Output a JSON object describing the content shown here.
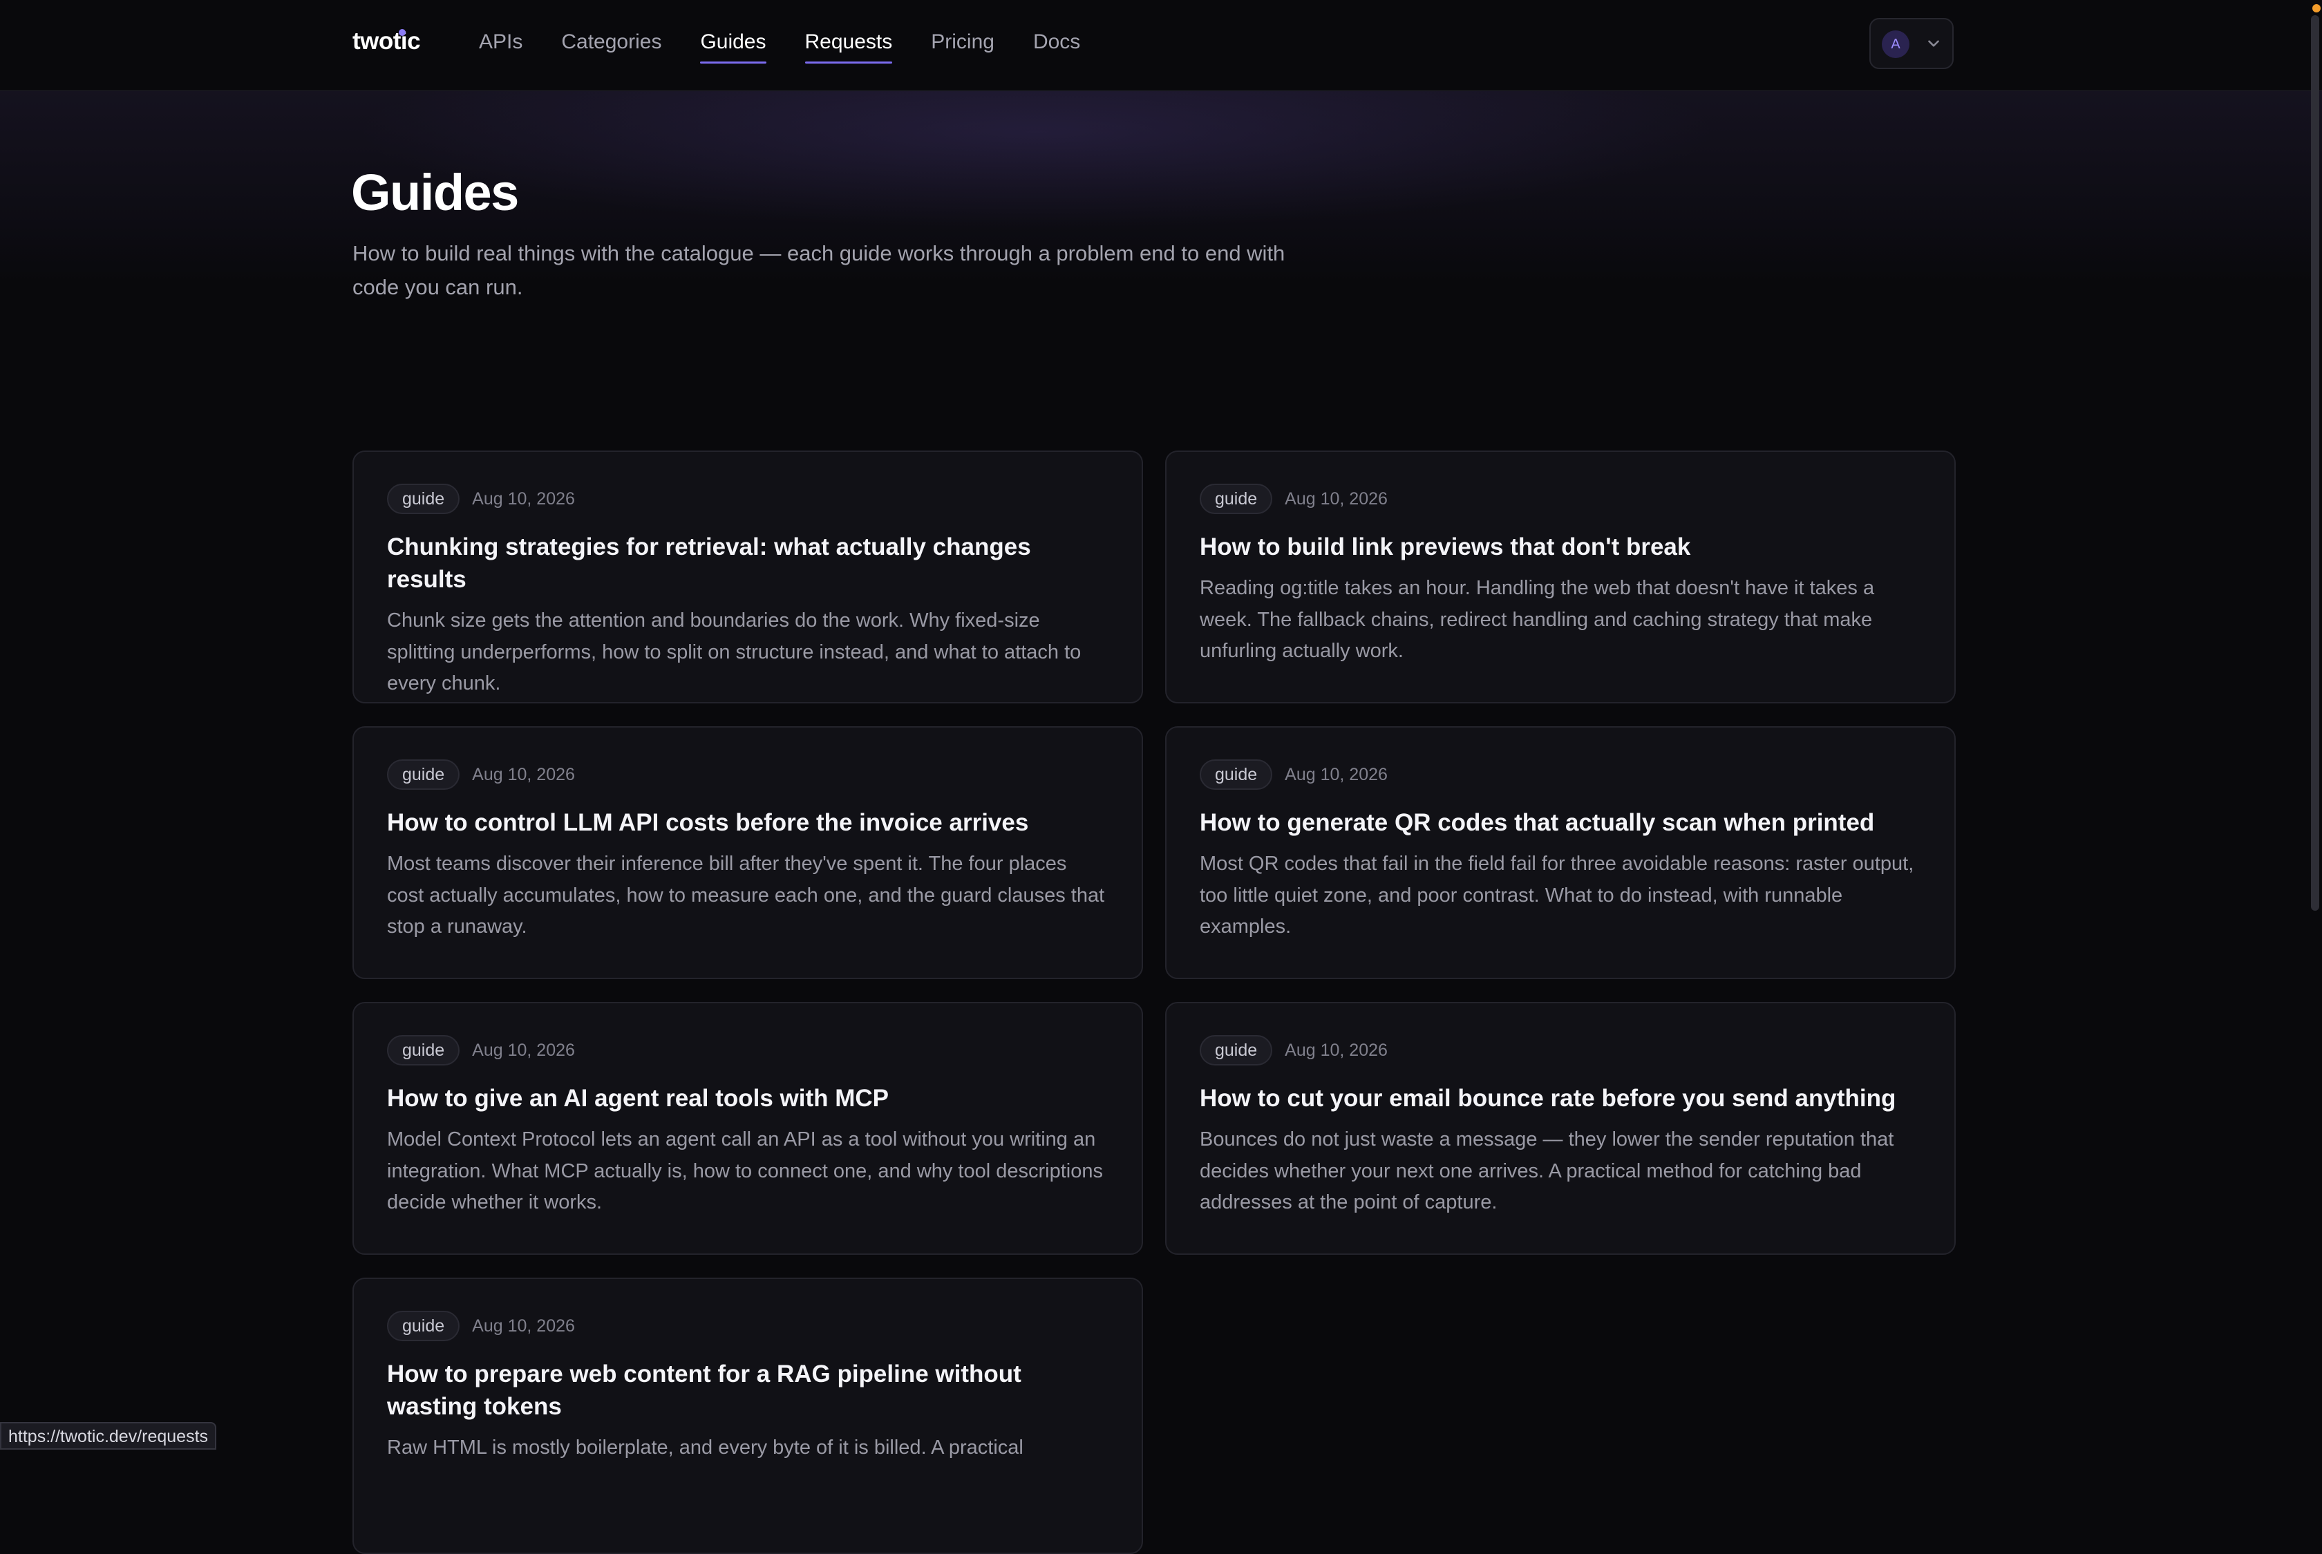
{
  "header": {
    "logo": "twotic",
    "nav": [
      {
        "label": "APIs",
        "active": false
      },
      {
        "label": "Categories",
        "active": false
      },
      {
        "label": "Guides",
        "active": true
      },
      {
        "label": "Requests",
        "active": true
      },
      {
        "label": "Pricing",
        "active": false
      },
      {
        "label": "Docs",
        "active": false
      }
    ],
    "account": {
      "avatar_initial": "A",
      "icon": "chevron-down-icon"
    }
  },
  "hero": {
    "title": "Guides",
    "subtitle": "How to build real things with the catalogue — each guide works through a problem end to end with code you can run."
  },
  "guides": [
    {
      "badge": "guide",
      "date": "Aug 10, 2026",
      "title": "Chunking strategies for retrieval: what actually changes results",
      "description": "Chunk size gets the attention and boundaries do the work. Why fixed-size splitting underperforms, how to split on structure instead, and what to attach to every chunk."
    },
    {
      "badge": "guide",
      "date": "Aug 10, 2026",
      "title": "How to build link previews that don't break",
      "description": "Reading og:title takes an hour. Handling the web that doesn't have it takes a week. The fallback chains, redirect handling and caching strategy that make unfurling actually work."
    },
    {
      "badge": "guide",
      "date": "Aug 10, 2026",
      "title": "How to control LLM API costs before the invoice arrives",
      "description": "Most teams discover their inference bill after they've spent it. The four places cost actually accumulates, how to measure each one, and the guard clauses that stop a runaway."
    },
    {
      "badge": "guide",
      "date": "Aug 10, 2026",
      "title": "How to generate QR codes that actually scan when printed",
      "description": "Most QR codes that fail in the field fail for three avoidable reasons: raster output, too little quiet zone, and poor contrast. What to do instead, with runnable examples."
    },
    {
      "badge": "guide",
      "date": "Aug 10, 2026",
      "title": "How to give an AI agent real tools with MCP",
      "description": "Model Context Protocol lets an agent call an API as a tool without you writing an integration. What MCP actually is, how to connect one, and why tool descriptions decide whether it works."
    },
    {
      "badge": "guide",
      "date": "Aug 10, 2026",
      "title": "How to cut your email bounce rate before you send anything",
      "description": "Bounces do not just waste a message — they lower the sender reputation that decides whether your next one arrives. A practical method for catching bad addresses at the point of capture."
    },
    {
      "badge": "guide",
      "date": "Aug 10, 2026",
      "title": "How to prepare web content for a RAG pipeline without wasting tokens",
      "description": "Raw HTML is mostly boilerplate, and every byte of it is billed. A practical"
    }
  ],
  "status_bar": {
    "url": "https://twotic.dev/requests"
  },
  "colors": {
    "background": "#09090c",
    "card": "#111116",
    "accent": "#7c6cf0",
    "notification": "#f39c2b"
  }
}
